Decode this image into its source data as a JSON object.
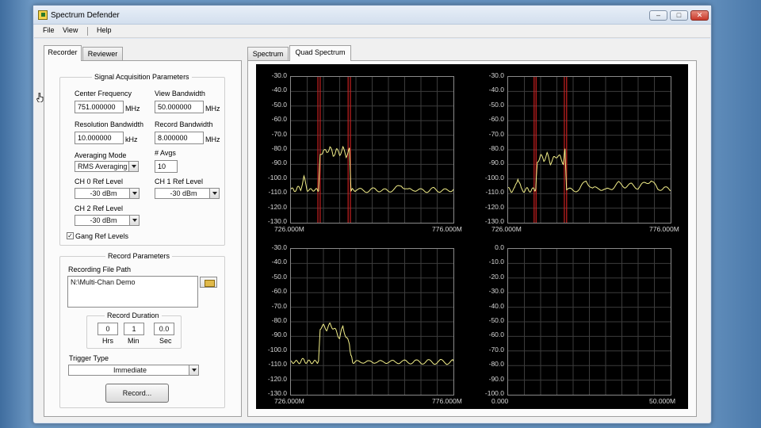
{
  "window": {
    "title": "Spectrum Defender",
    "controls": {
      "minimize": "–",
      "maximize": "□",
      "close": "✕"
    }
  },
  "menu": [
    "File",
    "View",
    "Help"
  ],
  "left_tabs": {
    "recorder": "Recorder",
    "reviewer": "Reviewer",
    "active": "Recorder"
  },
  "signal_acquisition": {
    "title": "Signal Acquisition Parameters",
    "center_frequency": {
      "label": "Center Frequency",
      "value": "751.000000",
      "unit": "MHz"
    },
    "view_bandwidth": {
      "label": "View Bandwidth",
      "value": "50.000000",
      "unit": "MHz"
    },
    "resolution_bandwidth": {
      "label": "Resolution Bandwidth",
      "value": "10.000000",
      "unit": "kHz"
    },
    "record_bandwidth": {
      "label": "Record Bandwidth",
      "value": "8.000000",
      "unit": "MHz"
    },
    "averaging_mode": {
      "label": "Averaging Mode",
      "value": "RMS Averaging"
    },
    "num_avgs": {
      "label": "# Avgs",
      "value": "10"
    },
    "ch0_ref": {
      "label": "CH 0 Ref Level",
      "value": "-30 dBm"
    },
    "ch1_ref": {
      "label": "CH 1 Ref Level",
      "value": "-30 dBm"
    },
    "ch2_ref": {
      "label": "CH 2 Ref Level",
      "value": "-30 dBm"
    },
    "gang_ref": {
      "label": "Gang Ref Levels",
      "checked": true,
      "mark": "✓"
    }
  },
  "record_parameters": {
    "title": "Record Parameters",
    "file_path_label": "Recording File Path",
    "file_path": "N:\\Multi-Chan Demo",
    "duration": {
      "title": "Record Duration",
      "hrs": {
        "value": "0",
        "label": "Hrs"
      },
      "min": {
        "value": "1",
        "label": "Min"
      },
      "sec": {
        "value": "0.0",
        "label": "Sec"
      }
    },
    "trigger_label": "Trigger Type",
    "trigger_value": "Immediate",
    "record_button": "Record..."
  },
  "right_tabs": {
    "spectrum": "Spectrum",
    "quad": "Quad Spectrum",
    "active": "Quad Spectrum"
  },
  "colors": {
    "trace": "#f4f08a",
    "marker": "#c82020",
    "grid": "#3c3c3c",
    "bg": "#000000"
  },
  "chart_data": [
    {
      "type": "line",
      "ytick_labels": [
        "-30.0",
        "-40.0",
        "-50.0",
        "-60.0",
        "-70.0",
        "-80.0",
        "-90.0",
        "-100.0",
        "-110.0",
        "-120.0",
        "-130.0"
      ],
      "xtick_labels": [
        "726.000M",
        "776.000M"
      ],
      "ylim": [
        -130,
        -30
      ],
      "xlim": [
        726,
        776
      ],
      "markers": [
        734.3,
        735.0,
        743.6,
        744.3
      ],
      "series": [
        {
          "x": [
            726,
            727,
            728,
            729,
            730,
            731,
            732,
            733,
            734,
            734.5,
            735,
            736,
            737,
            738,
            739,
            740,
            741,
            742,
            743,
            744,
            744.5,
            745,
            746,
            748,
            750,
            752,
            754,
            756,
            758,
            760,
            762,
            764,
            766,
            768,
            770,
            772,
            774,
            776
          ],
          "y": [
            -107,
            -108,
            -106,
            -107,
            -99,
            -107,
            -108,
            -107,
            -108,
            -107,
            -84,
            -80,
            -82,
            -78,
            -84,
            -80,
            -83,
            -79,
            -84,
            -80,
            -107,
            -108,
            -107,
            -108,
            -108,
            -107,
            -108,
            -108,
            -107,
            -104,
            -108,
            -107,
            -108,
            -108,
            -107,
            -108,
            -108,
            -107
          ]
        }
      ]
    },
    {
      "type": "line",
      "ytick_labels": [
        "-30.0",
        "-40.0",
        "-50.0",
        "-60.0",
        "-70.0",
        "-80.0",
        "-90.0",
        "-100.0",
        "-110.0",
        "-120.0",
        "-130.0"
      ],
      "xtick_labels": [
        "726.000M",
        "776.000M"
      ],
      "ylim": [
        -130,
        -30
      ],
      "xlim": [
        726,
        776
      ],
      "markers": [
        734.0,
        734.6,
        743.3,
        744.0
      ],
      "series": [
        {
          "x": [
            726,
            727,
            728,
            729,
            730,
            731,
            732,
            733,
            734,
            734.5,
            735,
            736,
            737,
            738,
            739,
            740,
            741,
            742,
            743,
            743.5,
            744,
            746,
            748,
            750,
            752,
            754,
            756,
            758,
            760,
            762,
            764,
            766,
            768,
            770,
            772,
            774,
            776
          ],
          "y": [
            -107,
            -108,
            -107,
            -99,
            -107,
            -108,
            -107,
            -108,
            -107,
            -107,
            -88,
            -84,
            -87,
            -83,
            -89,
            -86,
            -84,
            -85,
            -89,
            -80,
            -107,
            -108,
            -107,
            -101,
            -107,
            -106,
            -108,
            -106,
            -103,
            -105,
            -104,
            -106,
            -103,
            -101,
            -107,
            -106,
            -108
          ]
        }
      ]
    },
    {
      "type": "line",
      "ytick_labels": [
        "-30.0",
        "-40.0",
        "-50.0",
        "-60.0",
        "-70.0",
        "-80.0",
        "-90.0",
        "-100.0",
        "-110.0",
        "-120.0",
        "-130.0"
      ],
      "xtick_labels": [
        "726.000M",
        "776.000M"
      ],
      "ylim": [
        -130,
        -30
      ],
      "xlim": [
        726,
        776
      ],
      "markers": [],
      "series": [
        {
          "x": [
            726,
            727,
            728,
            729,
            730,
            731,
            732,
            733,
            734,
            734.5,
            735,
            736,
            737,
            738,
            739,
            740,
            741,
            742,
            743,
            744,
            744.5,
            745,
            746,
            748,
            750,
            752,
            754,
            756,
            758,
            760,
            762,
            764,
            766,
            768,
            770,
            772,
            774,
            776
          ],
          "y": [
            -108,
            -107,
            -108,
            -107,
            -106,
            -108,
            -107,
            -108,
            -107,
            -108,
            -84,
            -83,
            -85,
            -82,
            -84,
            -87,
            -91,
            -83,
            -91,
            -95,
            -104,
            -107,
            -108,
            -107,
            -108,
            -107,
            -108,
            -107,
            -108,
            -107,
            -108,
            -107,
            -108,
            -107,
            -108,
            -107,
            -108,
            -107
          ]
        }
      ]
    },
    {
      "type": "line",
      "ytick_labels": [
        "0.0",
        "-10.0",
        "-20.0",
        "-30.0",
        "-40.0",
        "-50.0",
        "-60.0",
        "-70.0",
        "-80.0",
        "-90.0",
        "-100.0"
      ],
      "xtick_labels": [
        "0.000",
        "50.000M"
      ],
      "ylim": [
        -100,
        0
      ],
      "xlim": [
        0,
        50
      ],
      "markers": [],
      "series": []
    }
  ]
}
